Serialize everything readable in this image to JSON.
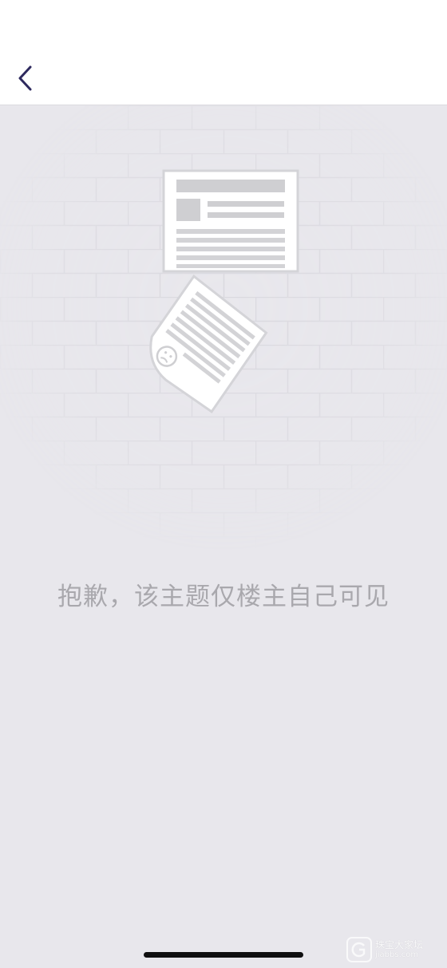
{
  "header": {
    "back_icon": "chevron-left-icon"
  },
  "empty_state": {
    "illustration_icon": "torn-document-on-brick-wall-icon",
    "message": "抱歉，该主题仅楼主自己可见"
  },
  "watermark": {
    "logo_icon": "g-logo-icon",
    "text": "珠宝大家坛",
    "subtext": "jiabbs.com"
  },
  "colors": {
    "header_bg": "#ffffff",
    "page_bg": "#e8e7ec",
    "back_icon": "#2e2a5e",
    "message_text": "#a9a8ad"
  }
}
